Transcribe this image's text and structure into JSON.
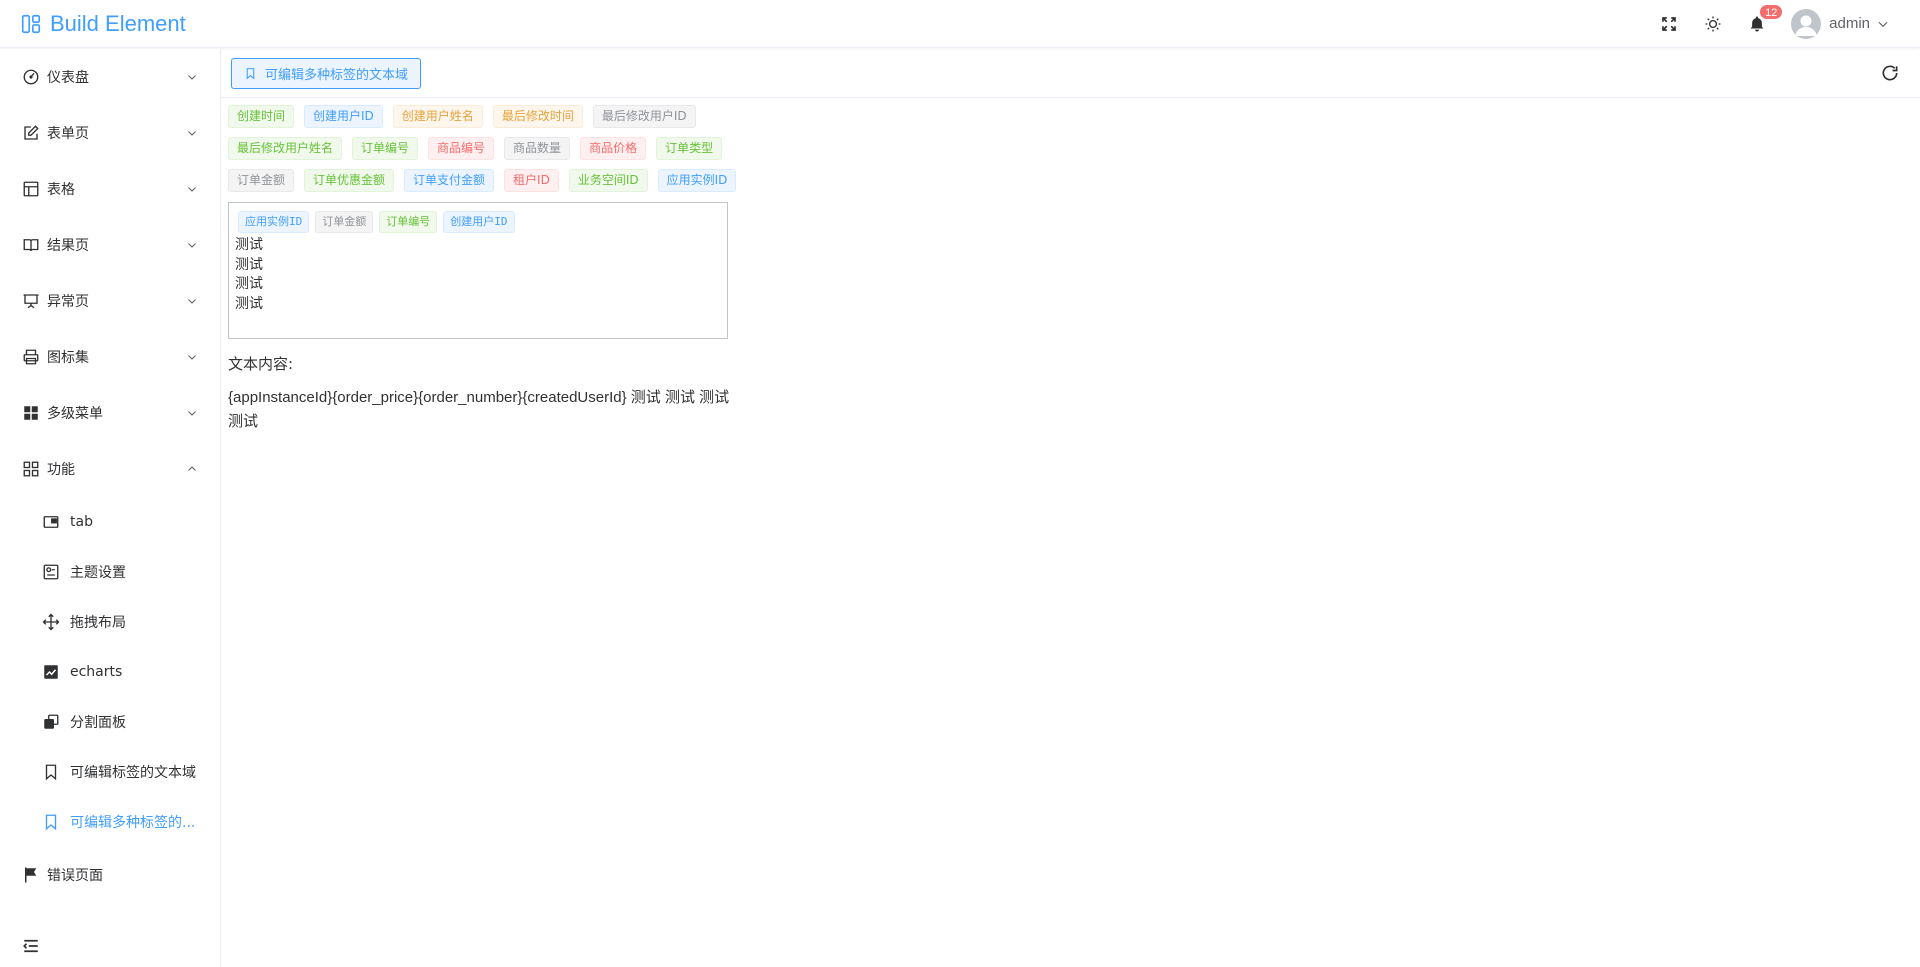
{
  "app": {
    "title": "Build Element"
  },
  "header": {
    "notification_count": "12",
    "username": "admin"
  },
  "sidebar": {
    "items": [
      {
        "label": "仪表盘"
      },
      {
        "label": "表单页"
      },
      {
        "label": "表格"
      },
      {
        "label": "结果页"
      },
      {
        "label": "异常页"
      },
      {
        "label": "图标集"
      },
      {
        "label": "多级菜单"
      },
      {
        "label": "功能"
      }
    ],
    "sub_items": [
      {
        "label": "tab"
      },
      {
        "label": "主题设置"
      },
      {
        "label": "拖拽布局"
      },
      {
        "label": "echarts"
      },
      {
        "label": "分割面板"
      },
      {
        "label": "可编辑标签的文本域"
      },
      {
        "label": "可编辑多种标签的..."
      }
    ],
    "after_items": [
      {
        "label": "错误页面"
      }
    ]
  },
  "tabs": {
    "active_label": "可编辑多种标签的文本域"
  },
  "tag_options": [
    {
      "label": "创建时间",
      "color": "green"
    },
    {
      "label": "创建用户ID",
      "color": "blue"
    },
    {
      "label": "创建用户姓名",
      "color": "orange"
    },
    {
      "label": "最后修改时间",
      "color": "orange"
    },
    {
      "label": "最后修改用户ID",
      "color": "gray"
    },
    {
      "label": "最后修改用户姓名",
      "color": "green"
    },
    {
      "label": "订单编号",
      "color": "green"
    },
    {
      "label": "商品编号",
      "color": "red"
    },
    {
      "label": "商品数量",
      "color": "gray"
    },
    {
      "label": "商品价格",
      "color": "red"
    },
    {
      "label": "订单类型",
      "color": "green"
    },
    {
      "label": "订单金额",
      "color": "gray"
    },
    {
      "label": "订单优惠金额",
      "color": "green"
    },
    {
      "label": "订单支付金额",
      "color": "blue"
    },
    {
      "label": "租户ID",
      "color": "red"
    },
    {
      "label": "业务空间ID",
      "color": "green"
    },
    {
      "label": "应用实例ID",
      "color": "blue"
    }
  ],
  "editor": {
    "tags": [
      {
        "label": "应用实例ID",
        "color": "blue"
      },
      {
        "label": "订单金额",
        "color": "gray"
      },
      {
        "label": "订单编号",
        "color": "green"
      },
      {
        "label": "创建用户ID",
        "color": "blue"
      }
    ],
    "lines": [
      "测试",
      "测试",
      "测试",
      "测试"
    ]
  },
  "output": {
    "label": "文本内容:",
    "text": "{appInstanceId}{order_price}{order_number}{createdUserId} 测试 测试 测试 测试"
  },
  "colors": {
    "accent": "#409eff"
  }
}
